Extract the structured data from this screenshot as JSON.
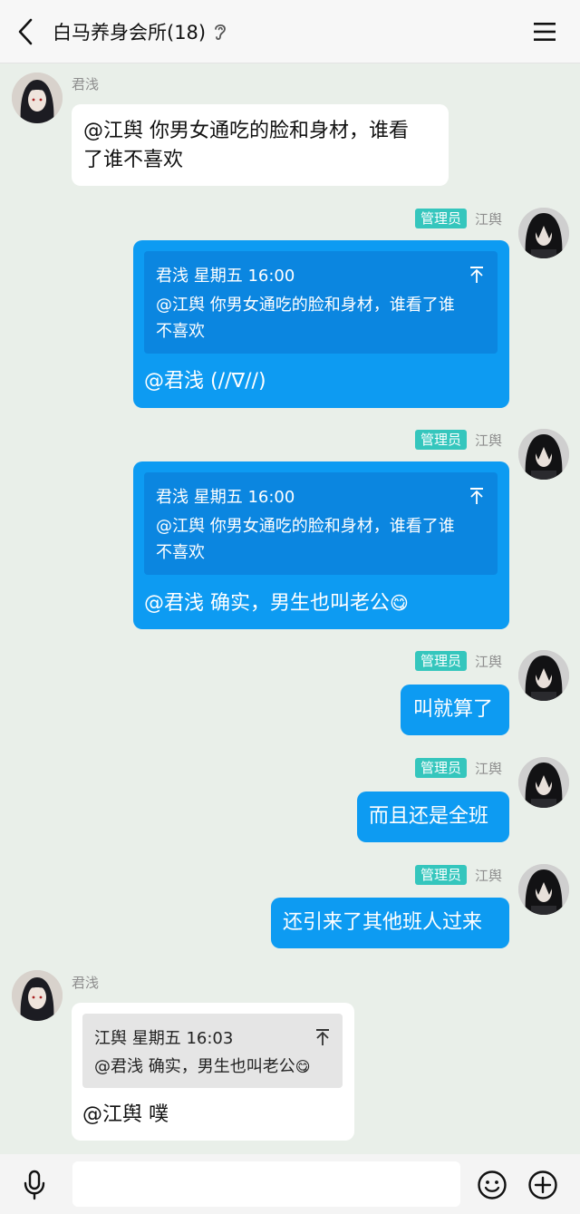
{
  "header": {
    "title": "白马养身会所(18)",
    "back_icon": "chevron-left-icon",
    "ear_icon": "ear-icon",
    "menu_icon": "hamburger-menu-icon"
  },
  "messages": [
    {
      "sender": "君浅",
      "direction": "incoming",
      "text_lines": [
        "@江舆 你男女通吃的脸和身材，谁看",
        "了谁不喜欢"
      ]
    },
    {
      "sender": "江舆",
      "badge": "管理员",
      "direction": "outgoing",
      "quote": {
        "author_time": "君浅 星期五 16:00",
        "text_lines": [
          "@江舆 你男女通吃的脸和身材，谁看了谁",
          "不喜欢"
        ]
      },
      "text": "@君浅 (//∇//)"
    },
    {
      "sender": "江舆",
      "badge": "管理员",
      "direction": "outgoing",
      "quote": {
        "author_time": "君浅 星期五 16:00",
        "text_lines": [
          "@江舆 你男女通吃的脸和身材，谁看了谁",
          "不喜欢"
        ]
      },
      "text": "@君浅 确实，男生也叫老公",
      "emoji": "😋"
    },
    {
      "sender": "江舆",
      "badge": "管理员",
      "direction": "outgoing",
      "text": "叫就算了"
    },
    {
      "sender": "江舆",
      "badge": "管理员",
      "direction": "outgoing",
      "text": "而且还是全班"
    },
    {
      "sender": "江舆",
      "badge": "管理员",
      "direction": "outgoing",
      "text": "还引来了其他班人过来"
    },
    {
      "sender": "君浅",
      "direction": "incoming",
      "quote": {
        "author_time": "江舆 星期五 16:03",
        "text": "@君浅 确实，男生也叫老公",
        "emoji": "😋"
      },
      "text": "@江舆 噗"
    }
  ],
  "input_bar": {
    "voice_icon": "microphone-icon",
    "input_value": "",
    "emoji_icon": "smiley-icon",
    "plus_icon": "plus-circle-icon"
  },
  "colors": {
    "background": "#e9efe9",
    "outgoing_bubble": "#0d9bf2",
    "outgoing_quote": "#0b86e0",
    "incoming_bubble": "#ffffff",
    "incoming_quote": "#e5e5e5",
    "admin_badge": "#35c6bd"
  }
}
